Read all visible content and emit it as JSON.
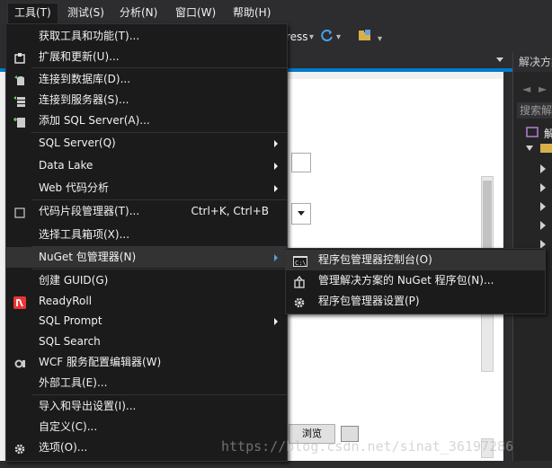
{
  "menubar": {
    "items": [
      {
        "label": "工具(T)"
      },
      {
        "label": "测试(S)"
      },
      {
        "label": "分析(N)"
      },
      {
        "label": "窗口(W)"
      },
      {
        "label": "帮助(H)"
      }
    ]
  },
  "toolbar": {
    "ress_label": "ress",
    "dropdown_glyph": "▾"
  },
  "solution_explorer": {
    "title": "解决方案",
    "search_placeholder": "搜索解",
    "item_label": "解"
  },
  "editor": {
    "browse_label": "浏览"
  },
  "tools_menu": {
    "items": [
      {
        "label": "获取工具和功能(T)..."
      },
      {
        "label": "扩展和更新(U)..."
      },
      {
        "label": "连接到数据库(D)..."
      },
      {
        "label": "连接到服务器(S)..."
      },
      {
        "label": "添加 SQL Server(A)..."
      },
      {
        "label": "SQL Server(Q)"
      },
      {
        "label": "Data Lake"
      },
      {
        "label": "Web 代码分析"
      },
      {
        "label": "代码片段管理器(T)...",
        "shortcut": "Ctrl+K, Ctrl+B"
      },
      {
        "label": "选择工具箱项(X)..."
      },
      {
        "label": "NuGet 包管理器(N)"
      },
      {
        "label": "创建 GUID(G)"
      },
      {
        "label": "ReadyRoll"
      },
      {
        "label": "SQL Prompt"
      },
      {
        "label": "SQL Search"
      },
      {
        "label": "WCF 服务配置编辑器(W)"
      },
      {
        "label": "外部工具(E)..."
      },
      {
        "label": "导入和导出设置(I)..."
      },
      {
        "label": "自定义(C)..."
      },
      {
        "label": "选项(O)..."
      }
    ]
  },
  "nuget_submenu": {
    "items": [
      {
        "label": "程序包管理器控制台(O)"
      },
      {
        "label": "管理解决方案的 NuGet 程序包(N)..."
      },
      {
        "label": "程序包管理器设置(P)"
      }
    ]
  },
  "watermark": {
    "text": "https://blog.csdn.net/sinat_36197286"
  },
  "colors": {
    "menu_bg": "#1b1b1c",
    "highlight": "#333334",
    "accent": "#007acc"
  }
}
